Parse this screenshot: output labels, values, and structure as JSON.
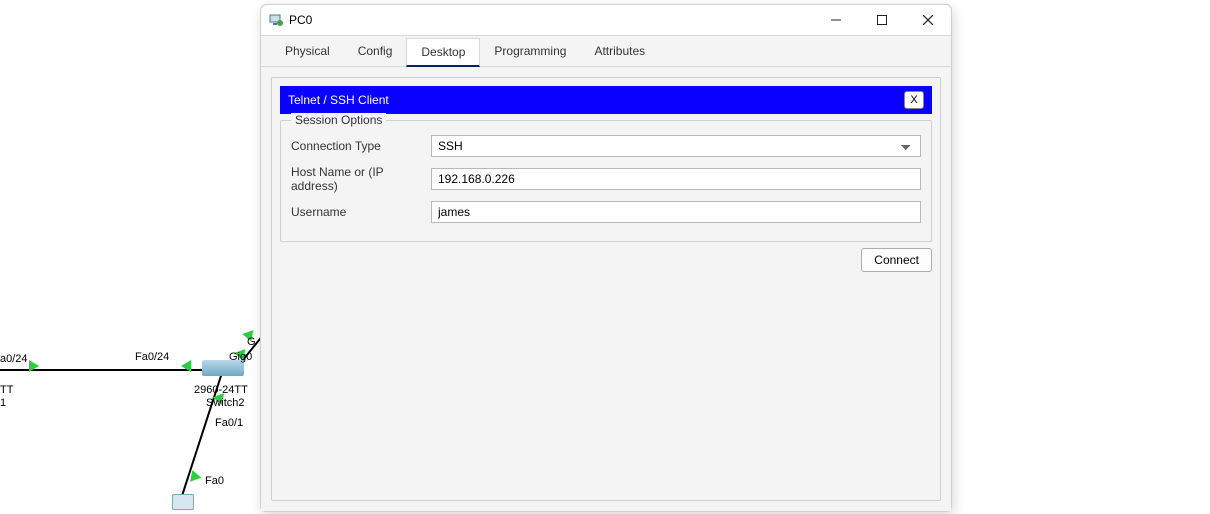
{
  "window": {
    "title": "PC0"
  },
  "tabs": [
    {
      "label": "Physical",
      "active": false
    },
    {
      "label": "Config",
      "active": false
    },
    {
      "label": "Desktop",
      "active": true
    },
    {
      "label": "Programming",
      "active": false
    },
    {
      "label": "Attributes",
      "active": false
    }
  ],
  "panel": {
    "title": "Telnet / SSH Client",
    "close_label": "X"
  },
  "form": {
    "group_legend": "Session Options",
    "connection_type_label": "Connection Type",
    "connection_type_value": "SSH",
    "host_label": "Host Name or (IP address)",
    "host_value": "192.168.0.226",
    "username_label": "Username",
    "username_value": "james",
    "connect_label": "Connect"
  },
  "topology": {
    "port_labels": {
      "left_switch_port": "a0/24",
      "left_switch_name1": "TT",
      "left_switch_name2": "1",
      "mid_port_left": "Fa0/24",
      "mid_port_right": "Gig0",
      "mid_switch_name1": "2960-24TT",
      "mid_switch_name2": "Switch2",
      "down_port": "Fa0/1",
      "pc_port_right_top": "G",
      "pc_port": "Fa0"
    }
  }
}
